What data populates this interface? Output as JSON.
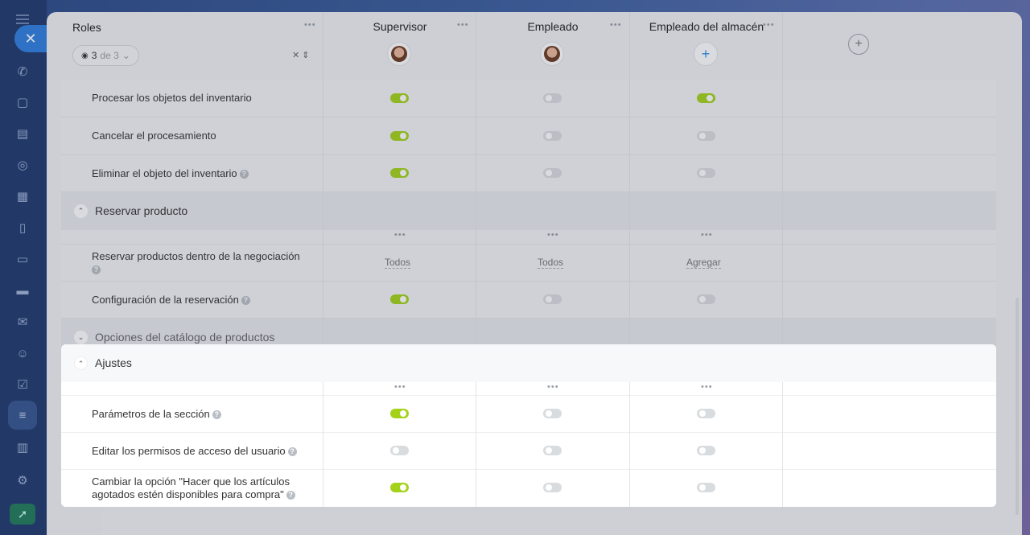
{
  "header": {
    "roles_label": "Roles",
    "counter_value": "3",
    "counter_suffix": "de 3",
    "columns": [
      "Supervisor",
      "Empleado",
      "Empleado del almacén"
    ]
  },
  "rows_top": [
    {
      "label": "Procesar los objetos del inventario",
      "help": false,
      "toggles": [
        true,
        false,
        true
      ]
    },
    {
      "label": "Cancelar el procesamiento",
      "help": false,
      "toggles": [
        true,
        false,
        false
      ]
    },
    {
      "label": "Eliminar el objeto del inventario",
      "help": true,
      "toggles": [
        true,
        false,
        false
      ]
    }
  ],
  "section_reserve": {
    "title": "Reservar producto",
    "rows": [
      {
        "label": "Reservar productos dentro de la negociación",
        "help": true,
        "values": [
          "Todos",
          "Todos",
          "Agregar"
        ]
      },
      {
        "label": "Configuración de la reservación",
        "help": true,
        "toggles": [
          true,
          false,
          false
        ]
      }
    ]
  },
  "section_catalog": {
    "title": "Opciones del catálogo de productos"
  },
  "section_settings": {
    "title": "Ajustes",
    "rows": [
      {
        "label": "Parámetros de la sección",
        "help": true,
        "toggles": [
          true,
          false,
          false
        ]
      },
      {
        "label": "Editar los permisos de acceso del usuario",
        "help": true,
        "toggles": [
          false,
          false,
          false
        ]
      },
      {
        "label_line1": "Cambiar la opción \"Hacer que los artículos",
        "label_line2": "agotados estén disponibles para compra\"",
        "help": true,
        "toggles": [
          true,
          false,
          false
        ]
      }
    ]
  },
  "icons": {
    "close": "close-icon",
    "add_column": "plus-icon",
    "more": "more-dots-icon"
  },
  "colors": {
    "toggle_on": "#a4d21a",
    "toggle_off": "#d9dcdf",
    "accent": "#2f7fe0"
  }
}
